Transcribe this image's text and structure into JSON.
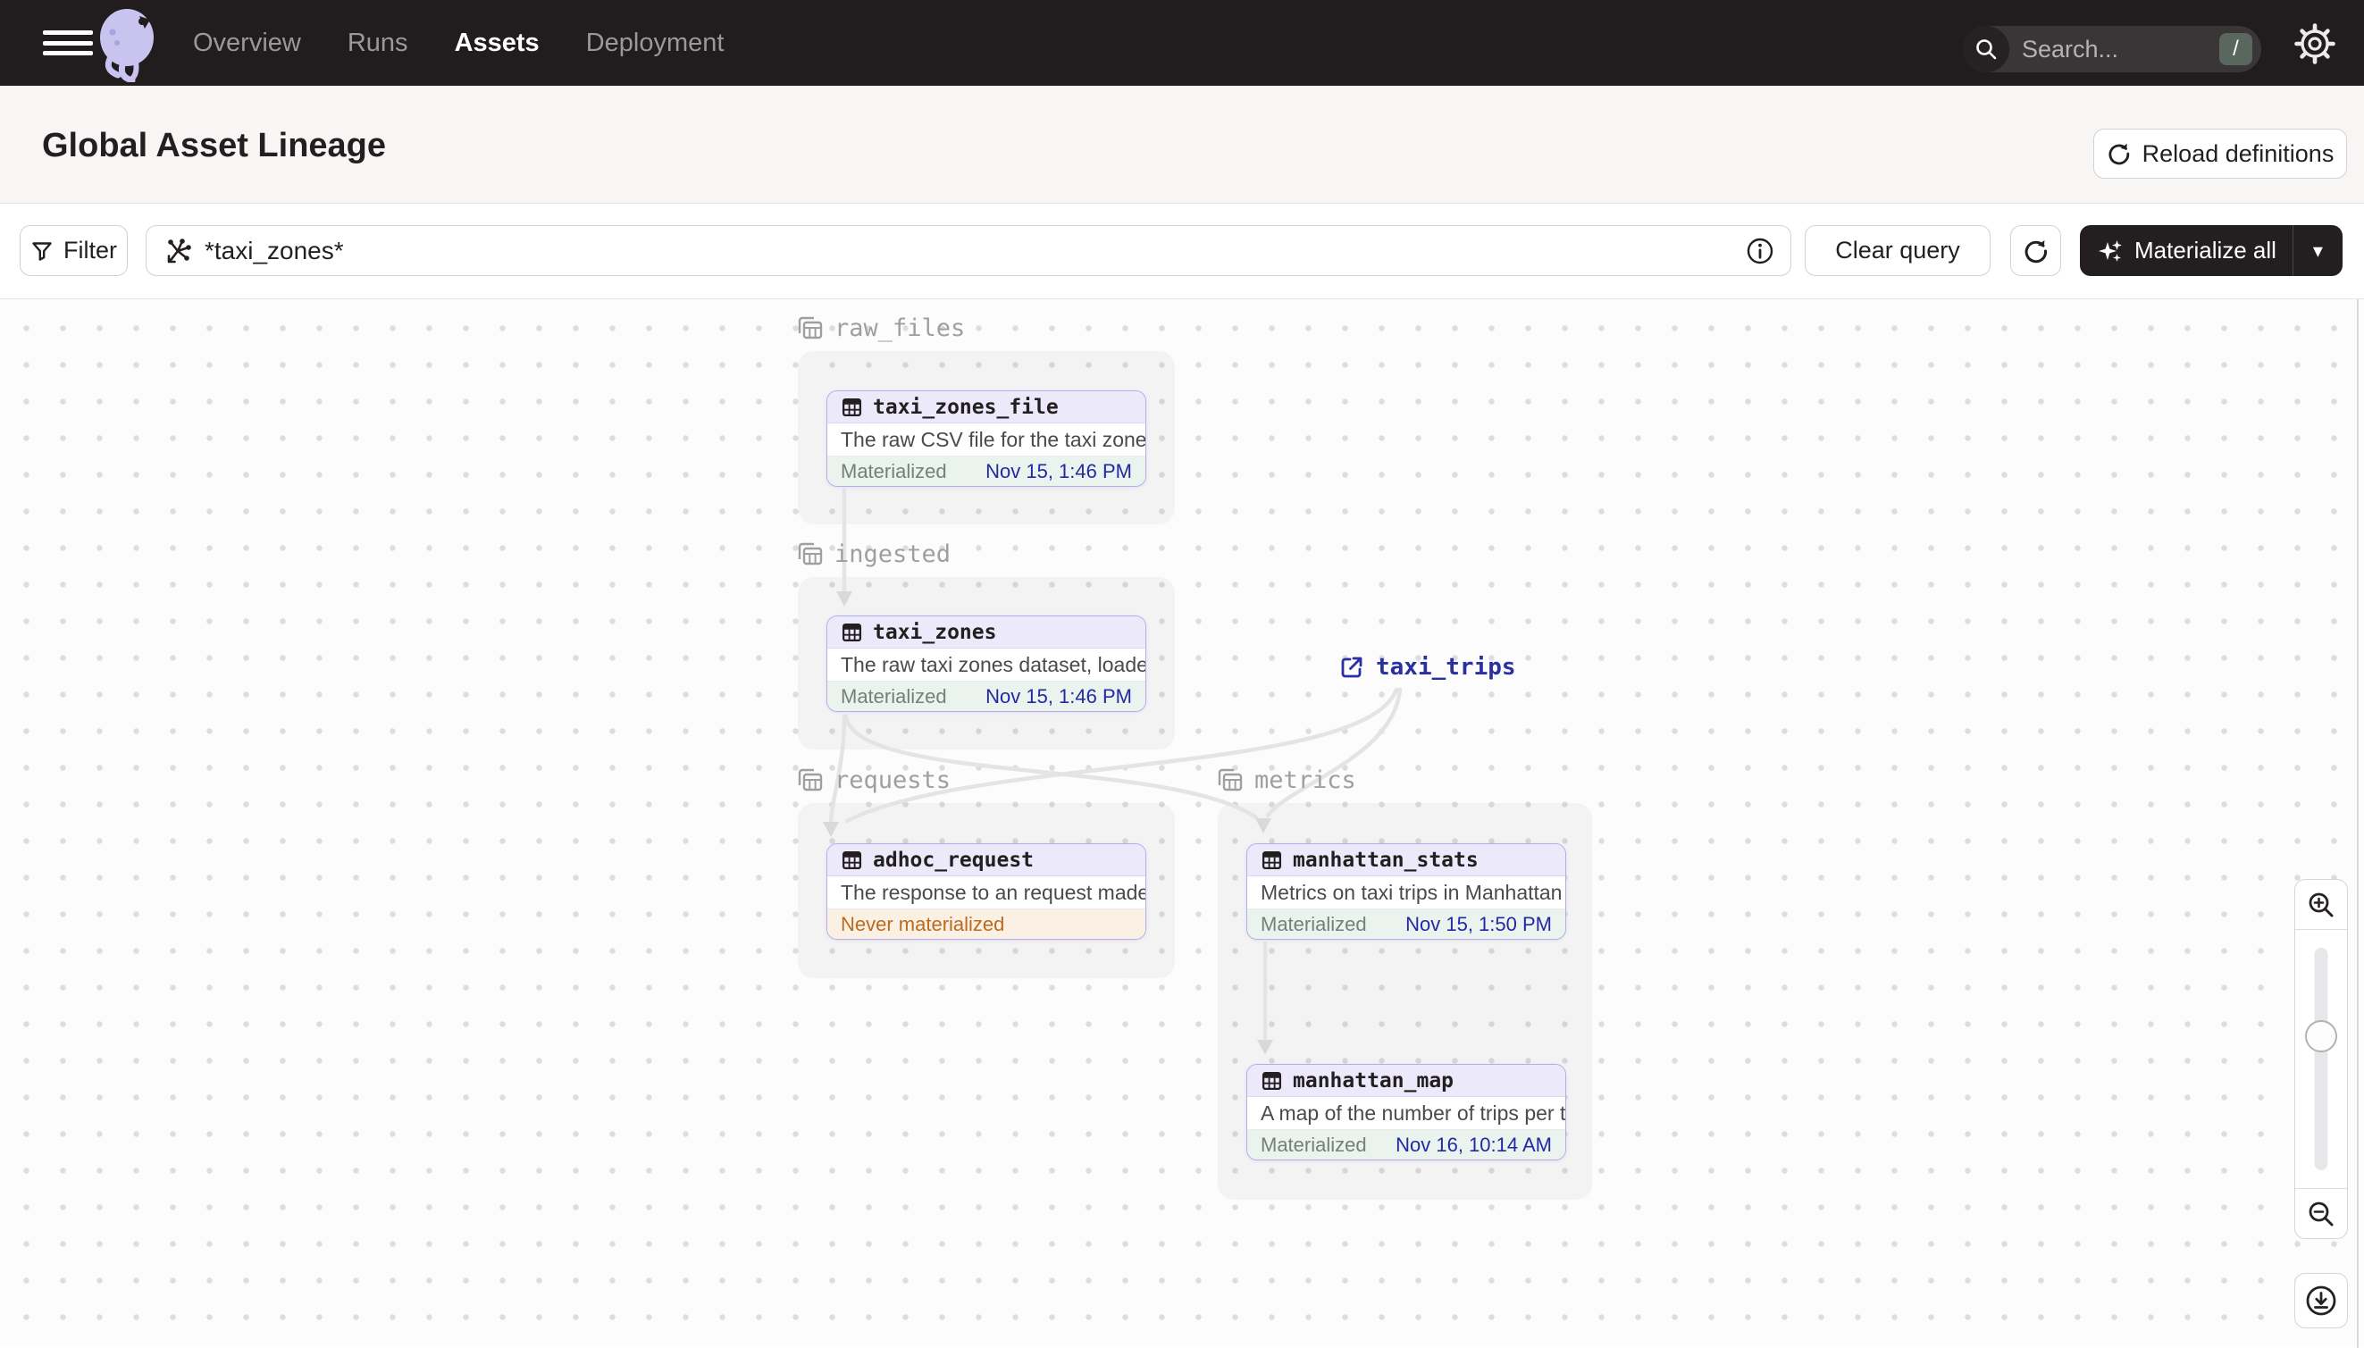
{
  "topnav": {
    "items": [
      {
        "label": "Overview",
        "active": false
      },
      {
        "label": "Runs",
        "active": false
      },
      {
        "label": "Assets",
        "active": true
      },
      {
        "label": "Deployment",
        "active": false
      }
    ],
    "search_placeholder": "Search...",
    "search_shortcut": "/"
  },
  "header": {
    "title": "Global Asset Lineage",
    "reload_button": "Reload definitions"
  },
  "toolbar": {
    "filter_label": "Filter",
    "query_value": "*taxi_zones*",
    "clear_label": "Clear query",
    "materialize_label": "Materialize all",
    "materialize_caret": "▾"
  },
  "graph": {
    "groups": [
      {
        "name": "raw_files"
      },
      {
        "name": "ingested"
      },
      {
        "name": "requests"
      },
      {
        "name": "metrics"
      }
    ],
    "nodes": [
      {
        "title": "taxi_zones_file",
        "group": "raw_files",
        "description": "The raw CSV file for the taxi zones dat...",
        "status": "Materialized",
        "timestamp": "Nov 15, 1:46 PM"
      },
      {
        "title": "taxi_zones",
        "group": "ingested",
        "description": "The raw taxi zones dataset, loaded int...",
        "status": "Materialized",
        "timestamp": "Nov 15, 1:46 PM"
      },
      {
        "title": "adhoc_request",
        "group": "requests",
        "description": "The response to an request made in th...",
        "status": "Never materialized",
        "timestamp": ""
      },
      {
        "title": "manhattan_stats",
        "group": "metrics",
        "description": "Metrics on taxi trips in Manhattan",
        "status": "Materialized",
        "timestamp": "Nov 15, 1:50 PM"
      },
      {
        "title": "manhattan_map",
        "group": "metrics",
        "description": "A map of the number of trips per taxi z...",
        "status": "Materialized",
        "timestamp": "Nov 16, 10:14 AM"
      }
    ],
    "external_assets": [
      {
        "title": "taxi_trips"
      }
    ],
    "edges": [
      {
        "source": "taxi_zones_file",
        "target": "taxi_zones"
      },
      {
        "source": "taxi_zones",
        "target": "adhoc_request"
      },
      {
        "source": "taxi_zones",
        "target": "manhattan_stats"
      },
      {
        "source": "taxi_trips",
        "target": "adhoc_request"
      },
      {
        "source": "taxi_trips",
        "target": "manhattan_stats"
      },
      {
        "source": "manhattan_stats",
        "target": "manhattan_map"
      }
    ]
  },
  "colors": {
    "topbar_bg": "#211D1E",
    "node_border": "#B5ABEE",
    "node_header_bg": "#ECE9FA",
    "materialized_bg": "#EAF3EE",
    "timestamp_text": "#2329A3",
    "never_materialized_text": "#BE6A1E",
    "never_materialized_bg": "#FAF1E4",
    "edge": "#E4E3E5"
  }
}
